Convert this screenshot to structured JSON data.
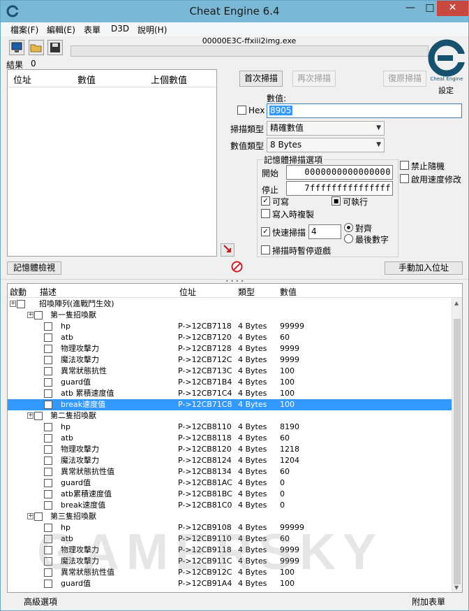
{
  "window": {
    "title": "Cheat Engine 6.4",
    "min": "—",
    "max": "□",
    "close": "✕"
  },
  "menu": [
    "檔案(F)",
    "編輯(E)",
    "表單",
    "D3D",
    "說明(H)"
  ],
  "process_title": "00000E3C-ffxiii2img.exe",
  "settings_label": "設定",
  "results": {
    "label": "結果",
    "count": "0",
    "columns": [
      "位址",
      "數值",
      "上個數值"
    ]
  },
  "scan": {
    "first_scan": "首次掃描",
    "next_scan": "再次掃描",
    "undo_scan": "復原掃描",
    "value_label": "數值:",
    "hex_label": "Hex",
    "value": "8905",
    "scan_type_label": "掃描類型",
    "scan_type": "精確數值",
    "value_type_label": "數值類型",
    "value_type": "8 Bytes"
  },
  "memory_options": {
    "title": "記憶體掃描選項",
    "start_label": "開始",
    "start_value": "0000000000000000",
    "stop_label": "停止",
    "stop_value": "7fffffffffffffff",
    "writable": "可寫",
    "executable": "可執行",
    "copy_on_write": "寫入時複製",
    "fast_scan": "快速掃描",
    "fast_scan_value": "4",
    "alignment": "對齊",
    "last_digits": "最後數字",
    "pause_game": "掃描時暫停遊戲"
  },
  "side_options": {
    "unrandomizer": "禁止隨機",
    "speedhack": "啟用速度修改"
  },
  "memory_view_button": "記憶體檢視",
  "add_address_button": "手動加入位址",
  "address_list": {
    "columns": [
      "啟動",
      "描述",
      "位址",
      "類型",
      "數值"
    ],
    "rows": [
      {
        "indent": 0,
        "expander": "+",
        "desc": "招喚陣列(進戰鬥生效)",
        "addr": "",
        "type": "",
        "value": "",
        "selected": false
      },
      {
        "indent": 1,
        "expander": "+",
        "desc": "第一隻招喚獸",
        "addr": "",
        "type": "",
        "value": "",
        "selected": false
      },
      {
        "indent": 2,
        "expander": "",
        "desc": "hp",
        "addr": "P->12CB7118",
        "type": "4 Bytes",
        "value": "99999",
        "selected": false
      },
      {
        "indent": 2,
        "expander": "",
        "desc": "atb",
        "addr": "P->12CB7120",
        "type": "4 Bytes",
        "value": "60",
        "selected": false
      },
      {
        "indent": 2,
        "expander": "",
        "desc": "物理攻擊力",
        "addr": "P->12CB7128",
        "type": "4 Bytes",
        "value": "9999",
        "selected": false
      },
      {
        "indent": 2,
        "expander": "",
        "desc": "魔法攻擊力",
        "addr": "P->12CB712C",
        "type": "4 Bytes",
        "value": "9999",
        "selected": false
      },
      {
        "indent": 2,
        "expander": "",
        "desc": "異常狀態抗性",
        "addr": "P->12CB713C",
        "type": "4 Bytes",
        "value": "100",
        "selected": false
      },
      {
        "indent": 2,
        "expander": "",
        "desc": "guard值",
        "addr": "P->12CB71B4",
        "type": "4 Bytes",
        "value": "100",
        "selected": false
      },
      {
        "indent": 2,
        "expander": "",
        "desc": "atb 累積速度值",
        "addr": "P->12CB71C4",
        "type": "4 Bytes",
        "value": "100",
        "selected": false
      },
      {
        "indent": 2,
        "expander": "",
        "desc": "break速度值",
        "addr": "P->12CB71C8",
        "type": "4 Bytes",
        "value": "100",
        "selected": true
      },
      {
        "indent": 1,
        "expander": "+",
        "desc": "第二隻招喚獸",
        "addr": "",
        "type": "",
        "value": "",
        "selected": false
      },
      {
        "indent": 2,
        "expander": "",
        "desc": "hp",
        "addr": "P->12CB8110",
        "type": "4 Bytes",
        "value": "8190",
        "selected": false
      },
      {
        "indent": 2,
        "expander": "",
        "desc": "atb",
        "addr": "P->12CB8118",
        "type": "4 Bytes",
        "value": "60",
        "selected": false
      },
      {
        "indent": 2,
        "expander": "",
        "desc": "物理攻擊力",
        "addr": "P->12CB8120",
        "type": "4 Bytes",
        "value": "1218",
        "selected": false
      },
      {
        "indent": 2,
        "expander": "",
        "desc": "魔法攻擊力",
        "addr": "P->12CB8124",
        "type": "4 Bytes",
        "value": "1204",
        "selected": false
      },
      {
        "indent": 2,
        "expander": "",
        "desc": "異常狀態抗性值",
        "addr": "P->12CB8134",
        "type": "4 Bytes",
        "value": "60",
        "selected": false
      },
      {
        "indent": 2,
        "expander": "",
        "desc": "guard值",
        "addr": "P->12CB81AC",
        "type": "4 Bytes",
        "value": "0",
        "selected": false
      },
      {
        "indent": 2,
        "expander": "",
        "desc": "atb累積速度值",
        "addr": "P->12CB81BC",
        "type": "4 Bytes",
        "value": "0",
        "selected": false
      },
      {
        "indent": 2,
        "expander": "",
        "desc": "break速度值",
        "addr": "P->12CB81C0",
        "type": "4 Bytes",
        "value": "0",
        "selected": false
      },
      {
        "indent": 1,
        "expander": "+",
        "desc": "第三隻招喚獸",
        "addr": "",
        "type": "",
        "value": "",
        "selected": false
      },
      {
        "indent": 2,
        "expander": "",
        "desc": "hp",
        "addr": "P->12CB9108",
        "type": "4 Bytes",
        "value": "99999",
        "selected": false
      },
      {
        "indent": 2,
        "expander": "",
        "desc": "atb",
        "addr": "P->12CB9110",
        "type": "4 Bytes",
        "value": "60",
        "selected": false
      },
      {
        "indent": 2,
        "expander": "",
        "desc": "物理攻擊力",
        "addr": "P->12CB9118",
        "type": "4 Bytes",
        "value": "9999",
        "selected": false
      },
      {
        "indent": 2,
        "expander": "",
        "desc": "魔法攻擊力",
        "addr": "P->12CB911C",
        "type": "4 Bytes",
        "value": "9999",
        "selected": false
      },
      {
        "indent": 2,
        "expander": "",
        "desc": "異常狀態抗性值",
        "addr": "P->12CB912C",
        "type": "4 Bytes",
        "value": "100",
        "selected": false
      },
      {
        "indent": 2,
        "expander": "",
        "desc": "guard值",
        "addr": "P->12CB91A4",
        "type": "4 Bytes",
        "value": "100",
        "selected": false
      }
    ]
  },
  "status": {
    "advanced": "高級選項",
    "table_extras": "附加表單"
  },
  "watermark": "GAMERSKY",
  "colors": {
    "selection": "#3399ff",
    "titlebar": "#7ab8d6",
    "close": "#c7483f"
  }
}
